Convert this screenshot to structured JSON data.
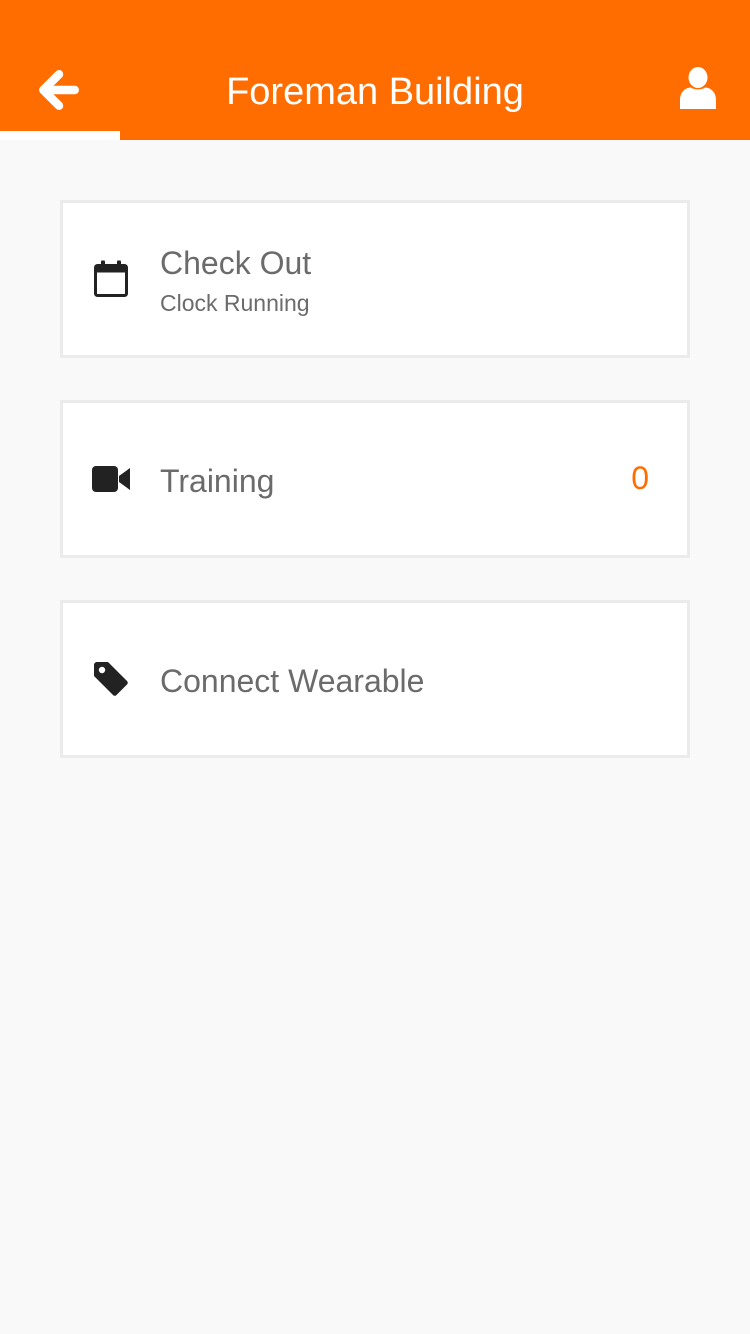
{
  "header": {
    "title": "Foreman Building",
    "back_icon": "arrow-left-icon",
    "profile_icon": "user-icon",
    "background_color": "#ff6d00"
  },
  "items": [
    {
      "label": "Check Out",
      "sublabel": "Clock Running",
      "icon": "calendar-icon"
    },
    {
      "label": "Training",
      "count": "0",
      "icon": "video-camera-icon"
    },
    {
      "label": "Connect Wearable",
      "icon": "tag-icon"
    }
  ],
  "colors": {
    "accent": "#ff6d00",
    "text": "#6b6b6b",
    "background": "#f9f9f9"
  }
}
